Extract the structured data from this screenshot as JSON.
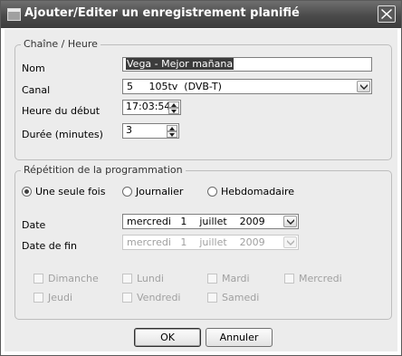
{
  "window": {
    "title": "Ajouter/Editer un enregistrement planifié"
  },
  "chaine_heure": {
    "legend": "Chaîne / Heure",
    "nom_label": "Nom",
    "nom_value": "Vega - Mejor mañana",
    "canal_label": "Canal",
    "canal_value": "5     105tv  (DVB-T)",
    "heure_label": "Heure du début",
    "heure_value": "17:03:54",
    "duree_label": "Durée (minutes)",
    "duree_value": "3"
  },
  "repetition": {
    "legend": "Répétition de la programmation",
    "options": [
      {
        "label": "Une seule fois",
        "selected": true
      },
      {
        "label": "Journalier",
        "selected": false
      },
      {
        "label": "Hebdomadaire",
        "selected": false
      }
    ],
    "date_label": "Date",
    "date_value": "mercredi   1    juillet    2009",
    "date_fin_label": "Date de fin",
    "date_fin_value": "mercredi   1    juillet    2009",
    "days": [
      "Dimanche",
      "Lundi",
      "Mardi",
      "Mercredi",
      "Jeudi",
      "Vendredi",
      "Samedi"
    ]
  },
  "buttons": {
    "ok": "OK",
    "cancel": "Annuler"
  },
  "icons": {
    "app": "window-icon",
    "close": "close-icon",
    "dropdown": "chevron-down-icon",
    "spinner": "spinner-arrows-icon"
  }
}
